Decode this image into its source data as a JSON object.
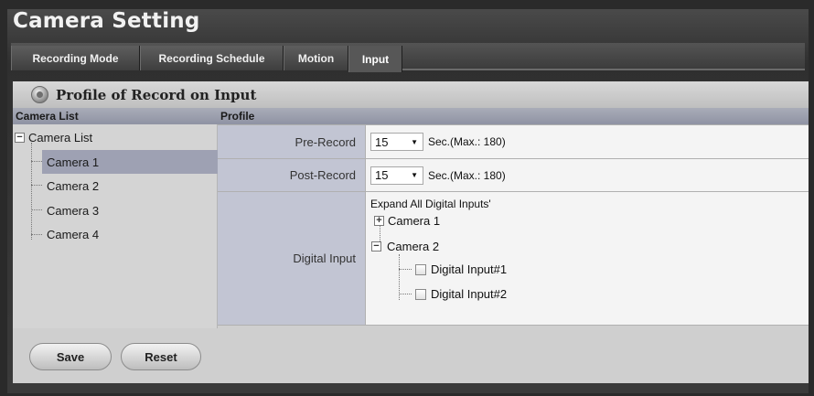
{
  "app": {
    "title": "Camera Setting"
  },
  "tabs": [
    {
      "label": "Recording Mode"
    },
    {
      "label": "Recording Schedule"
    },
    {
      "label": "Motion"
    },
    {
      "label": "Input"
    }
  ],
  "section": {
    "title": "Profile of Record on Input"
  },
  "columns": {
    "camera_list": "Camera List",
    "profile": "Profile"
  },
  "camera_tree": {
    "root": "Camera List",
    "expander": "−",
    "cameras": [
      "Camera 1",
      "Camera 2",
      "Camera 3",
      "Camera 4"
    ],
    "selected": "Camera 1"
  },
  "profile": {
    "pre_record": {
      "label": "Pre-Record",
      "value": "15",
      "hint": "Sec.(Max.: 180)"
    },
    "post_record": {
      "label": "Post-Record",
      "value": "15",
      "hint": "Sec.(Max.: 180)"
    },
    "digital_input": {
      "label": "Digital Input",
      "expand_all": "Expand All Digital Inputs'",
      "camera1": {
        "name": "Camera 1",
        "expander": "+"
      },
      "camera2": {
        "name": "Camera 2",
        "expander": "−"
      },
      "inputs": [
        "Digital Input#1",
        "Digital Input#2"
      ]
    }
  },
  "buttons": {
    "save": "Save",
    "reset": "Reset"
  },
  "icons": {
    "section": "camera-lens-icon",
    "dropdown": "caret-down-icon",
    "checkbox": "checkbox-unchecked"
  }
}
